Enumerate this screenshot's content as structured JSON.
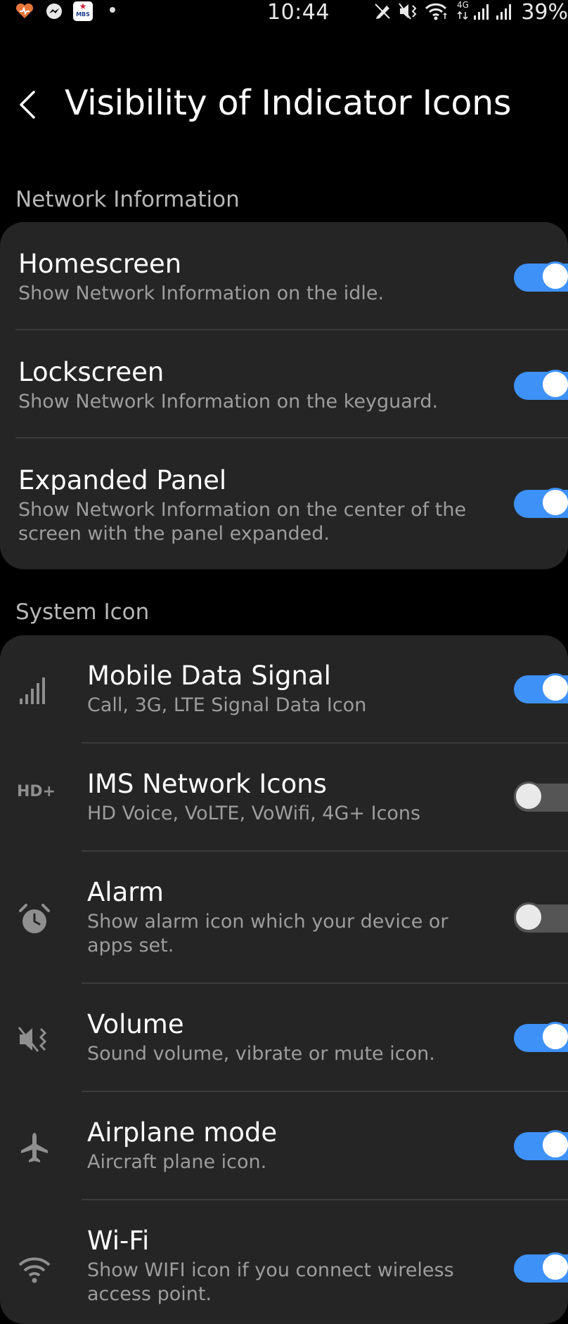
{
  "status_bar": {
    "time": "10:44",
    "battery": "39%",
    "network": "4G",
    "app_badge": "MBS"
  },
  "header": {
    "title": "Visibility of Indicator Icons"
  },
  "sections": [
    {
      "label": "Network Information",
      "items": [
        {
          "title": "Homescreen",
          "subtitle": "Show Network Information on the idle.",
          "enabled": true
        },
        {
          "title": "Lockscreen",
          "subtitle": "Show Network Information on the keyguard.",
          "enabled": true
        },
        {
          "title": "Expanded Panel",
          "subtitle": "Show Network Information on the center of the screen with the panel expanded.",
          "enabled": true
        }
      ]
    },
    {
      "label": "System Icon",
      "items": [
        {
          "title": "Mobile Data Signal",
          "subtitle": "Call, 3G, LTE Signal Data Icon",
          "icon": "signal-bars-icon",
          "enabled": true
        },
        {
          "title": "IMS Network Icons",
          "subtitle": "HD Voice, VoLTE, VoWifi, 4G+ Icons",
          "icon": "hd-plus-icon",
          "icon_text": "HD+",
          "enabled": false
        },
        {
          "title": "Alarm",
          "subtitle": "Show alarm icon which your device or apps set.",
          "icon": "alarm-clock-icon",
          "enabled": false
        },
        {
          "title": "Volume",
          "subtitle": "Sound volume, vibrate or mute icon.",
          "icon": "mute-vibrate-icon",
          "enabled": true
        },
        {
          "title": "Airplane mode",
          "subtitle": "Aircraft plane icon.",
          "icon": "airplane-icon",
          "enabled": true
        },
        {
          "title": "Wi-Fi",
          "subtitle": "Show WIFI icon if you connect wireless access point.",
          "icon": "wifi-icon",
          "enabled": true
        }
      ]
    }
  ],
  "colors": {
    "background": "#000000",
    "card": "#252525",
    "accent": "#3e91f7",
    "subtitle": "#9d9d9d",
    "section_label": "#b7b7b7"
  }
}
